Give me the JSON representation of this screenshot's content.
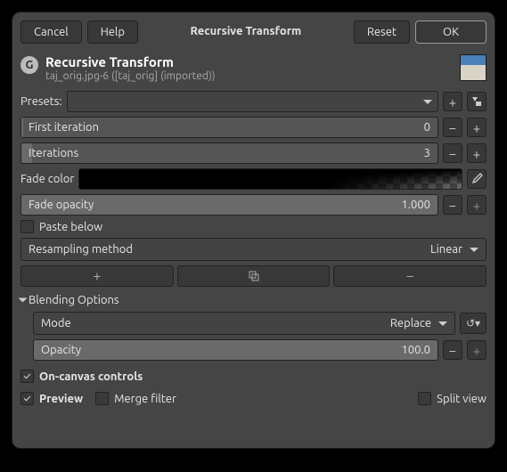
{
  "buttons": {
    "cancel": "Cancel",
    "help": "Help",
    "title": "Recursive Transform",
    "reset": "Reset",
    "ok": "OK"
  },
  "header": {
    "title": "Recursive Transform",
    "subtitle": "taj_orig.jpg-6 ([taj_orig] (imported))"
  },
  "presets": {
    "label": "Presets:"
  },
  "first_iter": {
    "label": "First iteration",
    "value": "0"
  },
  "iterations": {
    "label": "Iterations",
    "value": "3"
  },
  "fade_color": {
    "label": "Fade color"
  },
  "fade_opacity": {
    "label": "Fade opacity",
    "value": "1.000"
  },
  "paste_below": {
    "label": "Paste below"
  },
  "resampling": {
    "label": "Resampling method",
    "value": "Linear"
  },
  "blending": {
    "title": "Blending Options"
  },
  "mode": {
    "label": "Mode",
    "value": "Replace"
  },
  "opacity": {
    "label": "Opacity",
    "value": "100.0"
  },
  "on_canvas": {
    "label": "On-canvas controls"
  },
  "preview": {
    "label": "Preview"
  },
  "merge": {
    "label": "Merge filter"
  },
  "split": {
    "label": "Split view"
  }
}
